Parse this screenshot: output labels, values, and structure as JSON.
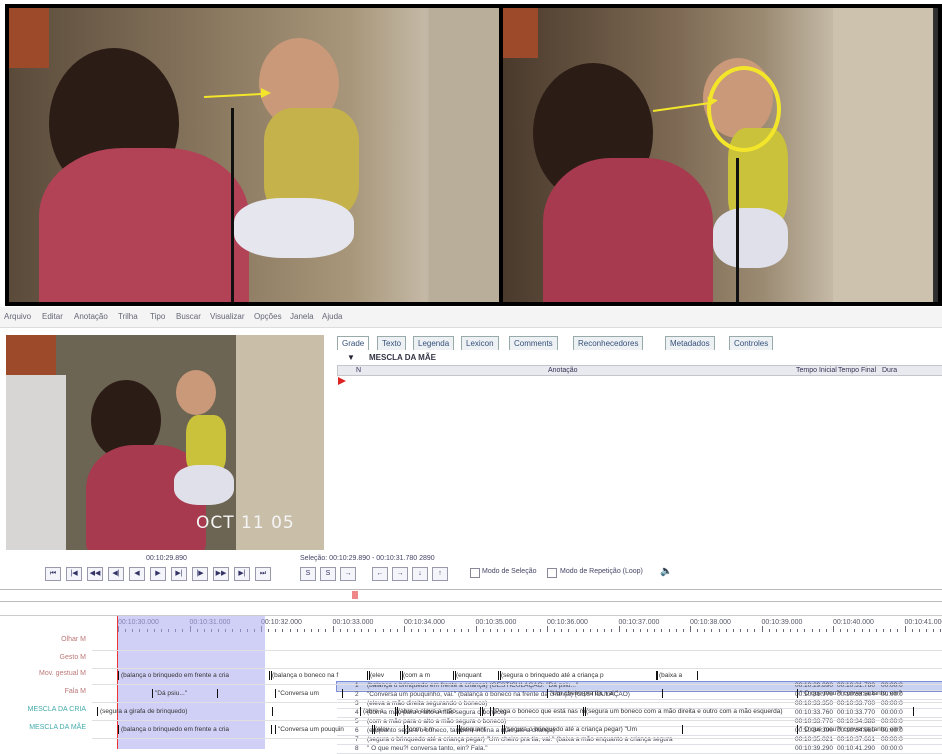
{
  "menu": [
    "Arquivo",
    "Editar",
    "Anotação",
    "Trilha",
    "Tipo",
    "Buscar",
    "Visualizar",
    "Opções",
    "Janela",
    "Ajuda"
  ],
  "video": {
    "timestamp": "OCT 11 05"
  },
  "tabs": [
    {
      "label": "Grade",
      "active": true
    },
    {
      "label": "Texto"
    },
    {
      "label": "Legenda"
    },
    {
      "label": "Lexicon"
    },
    {
      "label": "Comments"
    },
    {
      "label": "Reconhecedores"
    },
    {
      "label": "Metadados"
    },
    {
      "label": "Controles"
    }
  ],
  "grid": {
    "tier": "MESCLA DA MÃE",
    "columns": [
      "N",
      "Anotação",
      "Tempo Inicial",
      "Tempo Final",
      "Dura"
    ],
    "rows": [
      {
        "n": "1",
        "text": "(balança o brinquedo em frente a criança) (GESTICULAÇÃO: \"Dá psiu...\"",
        "start": "00:10:29.890",
        "end": "00:10:31.780",
        "dur": "00:00:0",
        "selected": true
      },
      {
        "n": "2",
        "text": "\"Conversa um pouquinho, vai.\" (balança o boneco na frente da criança) (GESTICULAÇÃO)",
        "start": "00:10:31.970",
        "end": "00:10:33.304",
        "dur": "00:00:0"
      },
      {
        "n": "3",
        "text": "(eleva a mão direita segurando o boneco)",
        "start": "00:10:33.350",
        "end": "00:10:33.700",
        "dur": "00:00:0"
      },
      {
        "n": "4",
        "text": "(com a mão para o alto a mão segura o boneco)",
        "start": "00:10:33.760",
        "end": "00:10:33.770",
        "dur": "00:00:0"
      },
      {
        "n": "5",
        "text": "(com a mão para o alto a mão segura o boneco)",
        "start": "00:10:33.776",
        "end": "00:10:34.388",
        "dur": "00:00:0"
      },
      {
        "n": "6",
        "text": "(enquanto segura o boneco, também inclina a mão até a criança)",
        "start": "00:10:34.390",
        "end": "00:10:34.980",
        "dur": "00:00:0"
      },
      {
        "n": "7",
        "text": "(segura o brinquedo até a criança pegar) \"Um cheiro pra tia, vai.\" (baixa a mão enquanto a criança segura",
        "start": "00:10:35.021",
        "end": "00:10:37.661",
        "dur": "00:00:0"
      },
      {
        "n": "8",
        "text": "\" O que meu?! conversa tanto, ein? Fala.\"",
        "start": "00:10:39.290",
        "end": "00:10:41.290",
        "dur": "00:00:0"
      }
    ]
  },
  "controls": {
    "current_time": "00:10:29.890",
    "selection": "Seleção: 00:10:29.890 - 00:10:31.780  2890",
    "selection_mode": "Modo de Seleção",
    "loop_mode": "Modo de Repetição (Loop)",
    "buttons": [
      "⏮",
      "|◀",
      "◀◀",
      "◀|",
      "◀",
      "▶",
      "▶|",
      "|▶",
      "▶▶",
      "▶|",
      "⏭"
    ],
    "buttons2": [
      "S",
      "S",
      "→"
    ],
    "buttons3": [
      "←",
      "→",
      "↓",
      "↑"
    ]
  },
  "timeline": {
    "ticks": [
      "00:10:30.000",
      "00:10:31.000",
      "00:10:32.000",
      "00:10:33.000",
      "00:10:34.000",
      "00:10:35.000",
      "00:10:36.000",
      "00:10:37.000",
      "00:10:38.000",
      "00:10:39.000",
      "00:10:40.000",
      "00:10:41.000"
    ],
    "tiers": [
      {
        "label": "Olhar M",
        "annotations": []
      },
      {
        "label": "Gesto M",
        "annotations": []
      },
      {
        "label": "Mov. gestual M",
        "annotations": [
          "(balança o brinquedo em frente a cria",
          "(balança o boneco na f",
          "(elev",
          "(com a m",
          "(enquant",
          "(segura o brinquedo até a criança p",
          "(baixa a"
        ]
      },
      {
        "label": "Fala M",
        "annotations": [
          "\"Dá psiu...\"",
          "\"Conversa um",
          "\"Um cheiro pra tia, vai.\"",
          "\" O que meu?! conversa tanto, ein?"
        ]
      },
      {
        "label": "MESCLA DA CRIA",
        "annotations": [
          "(segura a girafa de brinquedo)",
          "(abre a",
          "(abre e eleva a mão",
          "(",
          "(Pega o boneco que está nas m",
          "(segura um boneco com a mão direita e outro com a mão esquerda)"
        ]
      },
      {
        "label": "MESCLA DA MÃE",
        "annotations": [
          "(balança o brinquedo em frente a cria",
          "\"Conversa um pouquin",
          "(elev",
          "(com a m",
          "(enquant",
          "(segura o brinquedo até a criança pegar) \"Um",
          "\" O que meu?! conversa tanto, ein?"
        ]
      }
    ]
  },
  "colors": {
    "selection": "#c9d2f0",
    "timeline_selection": "#c7c7f5",
    "playhead": "#e33",
    "arrow": "#f3e62a"
  }
}
